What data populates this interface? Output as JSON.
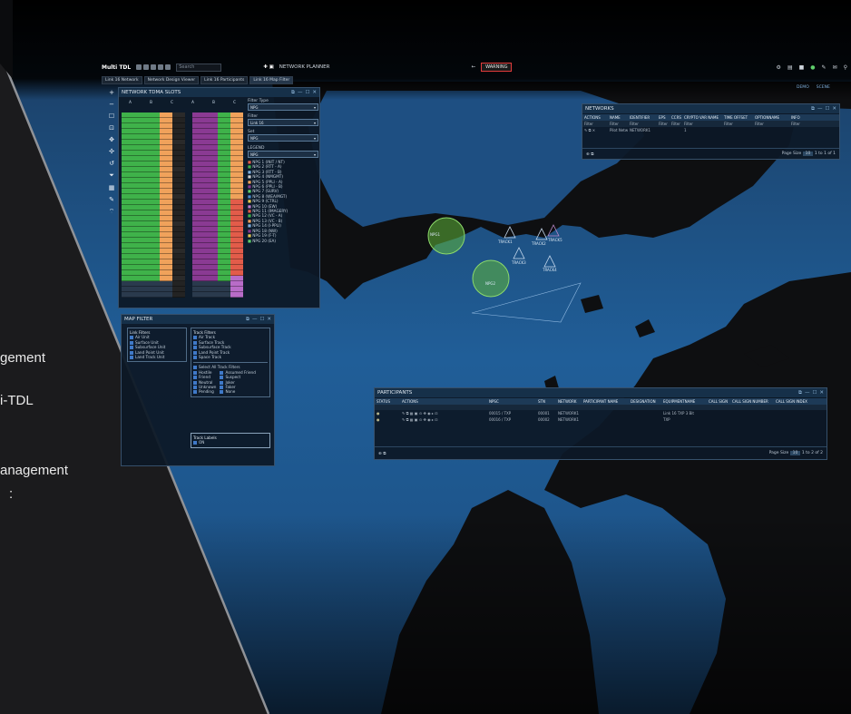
{
  "captions": [
    "gement",
    "i-TDL",
    "anagement",
    ":"
  ],
  "topbar": {
    "brand": "Multi TDL",
    "search_placeholder": "Search",
    "network_label": "NETWORK PLANNER",
    "alert_label": "WARNING"
  },
  "tabs": [
    "Link 16 Network",
    "Network Design Viewer",
    "Link 16 Participants",
    "Link 16 Map Filter"
  ],
  "tdma": {
    "title": "NETWORK TDMA SLOTS",
    "columns": [
      "A",
      "B",
      "C",
      "A",
      "B",
      "C"
    ],
    "filter_type_label": "Filter Type",
    "filter_type_value": "NPG",
    "filter_label": "Filter",
    "filter_value": "Link 16",
    "set_label": "Set",
    "set_value": "NPG",
    "legend_label": "LEGEND",
    "legend_value": "NPG",
    "legend_items": [
      "NPG 1 (INIT / NT)",
      "NPG 2 (RTT - A)",
      "NPG 3 (RTT - B)",
      "NPG 4 (NMGMT)",
      "NPG 5 (PPLI - A)",
      "NPG 6 (PPLI - B)",
      "NPG 7 (SURV)",
      "NPG 8 (WEA/MGT)",
      "NPG 9 (CTRL)",
      "NPG 10 (EW)",
      "NPG 11 (IMAGERY)",
      "NPG 12 (VC - A)",
      "NPG 13 (VC - B)",
      "NPG 14 (I-PPLI)",
      "NPG 18 (NW)",
      "NPG 19 (F-T)",
      "NPG 20 (EA)"
    ]
  },
  "map_filter": {
    "title": "MAP FILTER",
    "link_filters_label": "Link Filters",
    "link_filters": [
      "Air Unit",
      "Surface Unit",
      "Subsurface Unit",
      "Land Point Unit",
      "Land Track Unit"
    ],
    "track_filters_label": "Track Filters",
    "track_filters": [
      "Air Track",
      "Surface Track",
      "Subsurface Track",
      "Land Point Track",
      "Space Track"
    ],
    "select_all_label": "Select All Track Filters",
    "identities_left": [
      "Hostile",
      "Friend",
      "Neutral",
      "Unknown",
      "Pending"
    ],
    "identities_right": [
      "Assumed Friend",
      "Suspect",
      "Joker",
      "Faker",
      "None"
    ],
    "track_labels_label": "Track Labels",
    "track_labels_value": "ON"
  },
  "networks": {
    "title": "NETWORKS",
    "headers": [
      "ACTIONS",
      "NAME",
      "IDENTIFIER",
      "EPS",
      "CCRS",
      "CRYPTO VAR NAME",
      "TIME OFFSET",
      "OPTIONNAME",
      "INFO"
    ],
    "filter_label": "Filter",
    "row": [
      "",
      "Pilot Network",
      "NETWORK1",
      "",
      "",
      "1",
      "",
      "",
      ""
    ],
    "page_size_label": "Page Size",
    "page_size_value": "10",
    "page_info": "1 to 1 of 1"
  },
  "participants": {
    "title": "PARTICIPANTS",
    "headers": [
      "STATUS",
      "ACTIONS",
      "NPSC",
      "STN",
      "NETWORK",
      "PARTICIPANT NAME",
      "DESIGNATION",
      "EQUIPMENTNAME",
      "CALL SIGN",
      "CALL SIGN NUMBER",
      "CALL SIGN INDEX"
    ],
    "rows": [
      [
        "",
        "",
        "00015 / TXP",
        "00001",
        "NETWORK1",
        "",
        "",
        "Link 16 TXP 3 Bit",
        "",
        "",
        ""
      ],
      [
        "",
        "",
        "00016 / TXP",
        "00002",
        "NETWORK1",
        "",
        "",
        "TXP",
        "",
        "",
        ""
      ]
    ],
    "page_size_label": "Page Size",
    "page_size_value": "10",
    "page_info": "1 to 2 of 2"
  },
  "map": {
    "zoom_labels": [
      "DEMO",
      "SCENE"
    ],
    "track_labels": [
      "NPG1",
      "NPG2",
      "TRACK1",
      "TRACK2",
      "TRACK3",
      "TRACK4",
      "TRACK5"
    ]
  },
  "colors": {
    "sea": "#1f5a93",
    "land": "#0e0f11",
    "accent": "#4a8ed0",
    "green": "#3fb24a",
    "orange": "#f0a25b",
    "purple": "#8a3a93",
    "red": "#e25c4a"
  }
}
